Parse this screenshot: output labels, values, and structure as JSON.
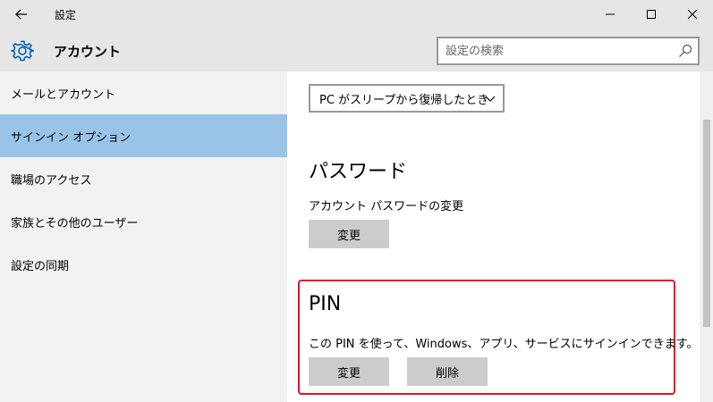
{
  "titlebar": {
    "title": "設定",
    "icons": {
      "back": "back-arrow-icon",
      "minimize": "minimize-icon",
      "maximize": "maximize-icon",
      "close": "close-icon"
    }
  },
  "header": {
    "icon": "gear-icon",
    "title": "アカウント",
    "search_placeholder": "設定の検索",
    "search_icon": "search-icon"
  },
  "sidebar": {
    "items": [
      {
        "label": "メールとアカウント",
        "selected": false
      },
      {
        "label": "サインイン オプション",
        "selected": true
      },
      {
        "label": "職場のアクセス",
        "selected": false
      },
      {
        "label": "家族とその他のユーザー",
        "selected": false
      },
      {
        "label": "設定の同期",
        "selected": false
      }
    ],
    "selected_color": "#99c4e8"
  },
  "main": {
    "dropdown_value": "PC がスリープから復帰したとき",
    "password": {
      "heading": "パスワード",
      "description": "アカウント パスワードの変更",
      "change_label": "変更"
    },
    "pin": {
      "heading": "PIN",
      "description": "この PIN を使って、Windows、アプリ、サービスにサインインできます。",
      "change_label": "変更",
      "remove_label": "削除",
      "highlight_color": "#e81123"
    }
  }
}
